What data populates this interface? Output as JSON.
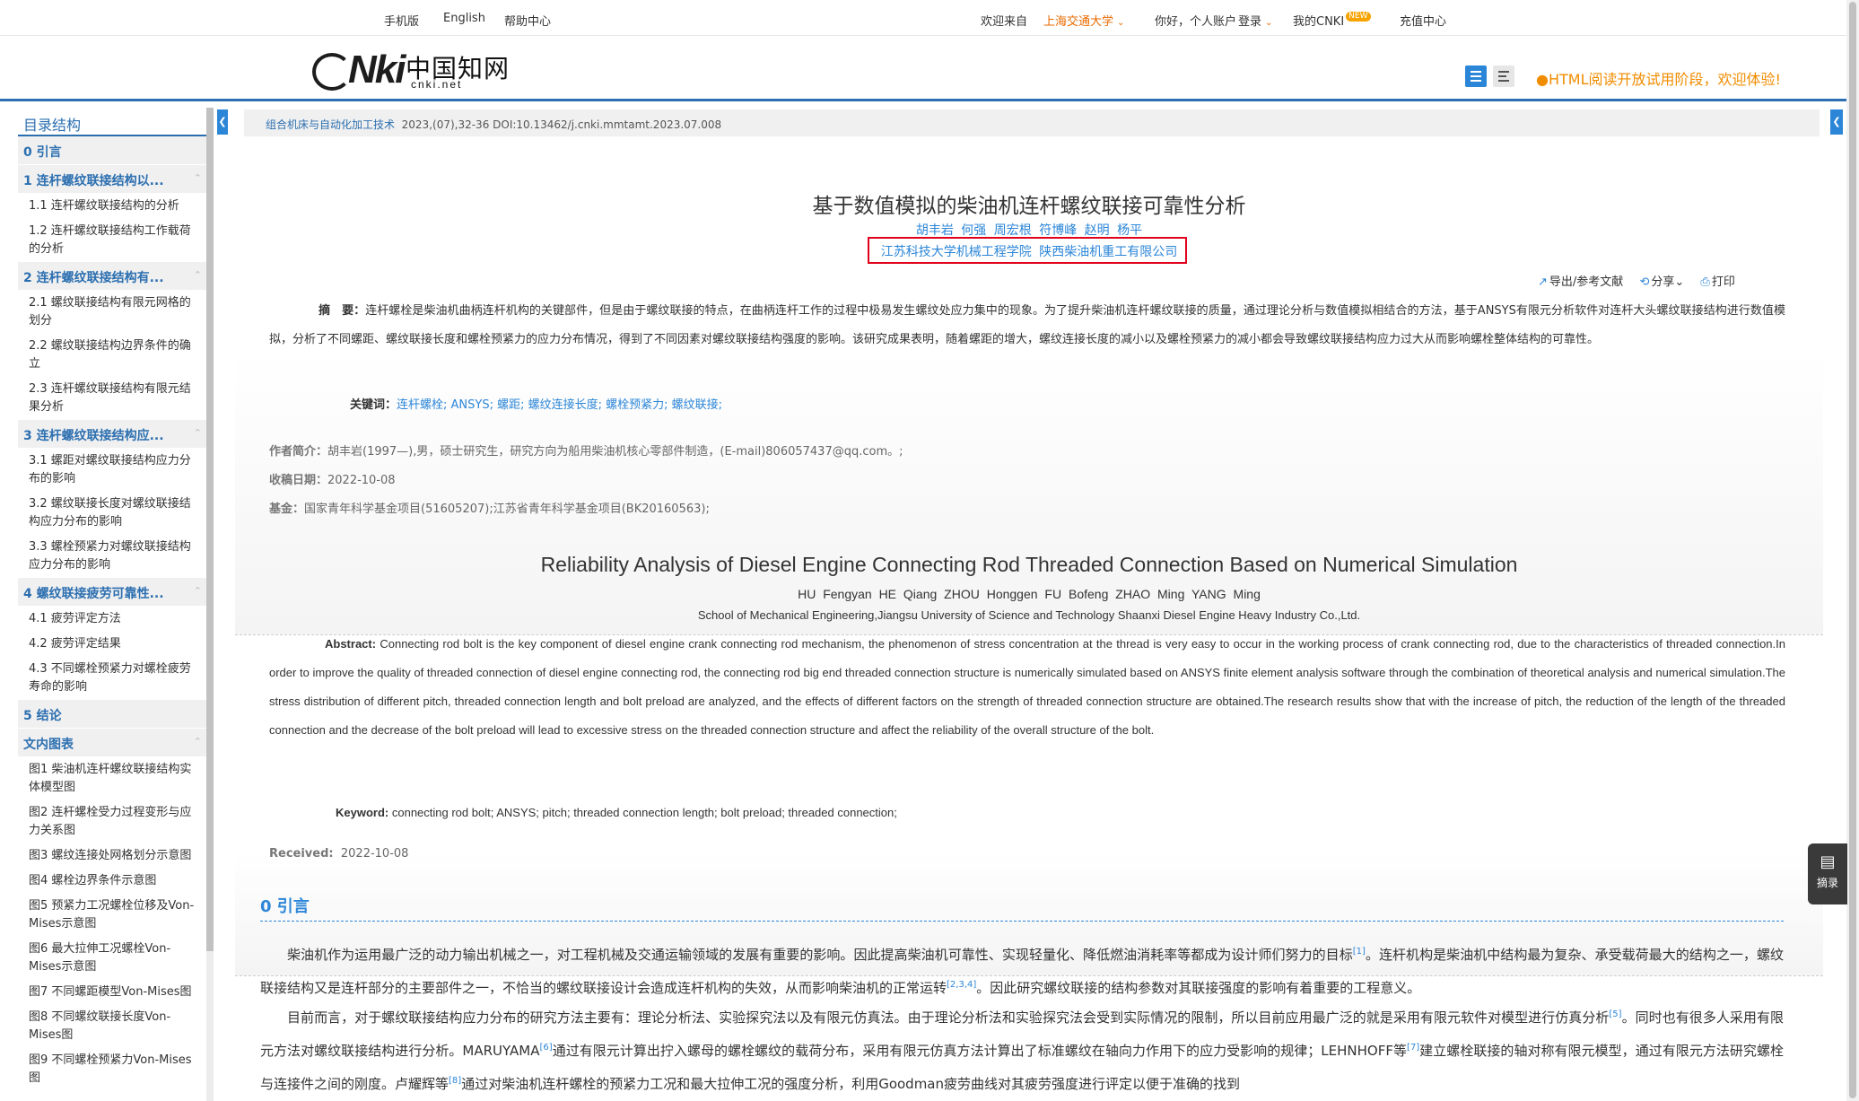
{
  "topbar": {
    "mobile": "手机版",
    "english": "English",
    "help": "帮助中心",
    "welcome": "欢迎来自",
    "institution": "上海交通大学",
    "greeting": "你好，个人账户",
    "login": "登录",
    "my_cnki": "我的CNKI",
    "new_badge": "NEW",
    "recharge": "充值中心"
  },
  "header": {
    "logo_text": "Nki",
    "logo_zh": "中国知网",
    "logo_net": "cnki.net",
    "notice": "HTML阅读开放试用阶段，欢迎体验!"
  },
  "toc": {
    "title": "目录结构",
    "sections": [
      {
        "label": "0 引言",
        "items": []
      },
      {
        "label": "1 连杆螺纹联接结构以...",
        "items": [
          "1.1 连杆螺纹联接结构的分析",
          "1.2 连杆螺纹联接结构工作载荷的分析"
        ]
      },
      {
        "label": "2 连杆螺纹联接结构有...",
        "items": [
          "2.1 螺纹联接结构有限元网格的划分",
          "2.2 螺纹联接结构边界条件的确立",
          "2.3 连杆螺纹联接结构有限元结果分析"
        ]
      },
      {
        "label": "3 连杆螺纹联接结构应...",
        "items": [
          "3.1 螺距对螺纹联接结构应力分布的影响",
          "3.2 螺纹联接长度对螺纹联接结构应力分布的影响",
          "3.3 螺栓预紧力对螺纹联接结构应力分布的影响"
        ]
      },
      {
        "label": "4 螺纹联接疲劳可靠性...",
        "items": [
          "4.1 疲劳评定方法",
          "4.2 疲劳评定结果",
          "4.3 不同螺栓预紧力对螺栓疲劳寿命的影响"
        ]
      },
      {
        "label": "5 结论",
        "items": []
      },
      {
        "label": "文内图表",
        "items": [
          "图1 柴油机连杆螺纹联接结构实体模型图",
          "图2 连杆螺栓受力过程变形与应力关系图",
          "图3 螺纹连接处网格划分示意图",
          "图4 螺栓边界条件示意图",
          "图5 预紧力工况螺栓位移及Von-Mises示意图",
          "图6 最大拉伸工况螺栓Von-Mises示意图",
          "图7 不同螺距模型Von-Mises图",
          "图8 不同螺纹联接长度Von-Mises图",
          "图9 不同螺栓预紧力Von-Mises图"
        ]
      }
    ]
  },
  "source": {
    "journal": "组合机床与自动化加工技术",
    "info": "2023,(07),32-36 DOI:10.13462/j.cnki.mmtamt.2023.07.008"
  },
  "article": {
    "title_zh": "基于数值模拟的柴油机连杆螺纹联接可靠性分析",
    "authors_zh": "胡丰岩 何强 周宏根 符博峰 赵明 杨平",
    "affil_zh": "江苏科技大学机械工程学院 陕西柴油机重工有限公司",
    "tools": {
      "export": "导出/参考文献",
      "share": "分享",
      "print": "打印"
    },
    "abstract_label_zh": "摘　要：",
    "abstract_zh": "连杆螺栓是柴油机曲柄连杆机构的关键部件，但是由于螺纹联接的特点，在曲柄连杆工作的过程中极易发生螺纹处应力集中的现象。为了提升柴油机连杆螺纹联接的质量，通过理论分析与数值模拟相结合的方法，基于ANSYS有限元分析软件对连杆大头螺纹联接结构进行数值模拟，分析了不同螺距、螺纹联接长度和螺栓预紧力的应力分布情况，得到了不同因素对螺纹联接结构强度的影响。该研究成果表明，随着螺距的增大，螺纹连接长度的减小以及螺栓预紧力的减小都会导致螺纹联接结构应力过大从而影响螺栓整体结构的可靠性。",
    "keywords_label_zh": "关键词：",
    "keywords_zh": "连杆螺栓; ANSYS; 螺距; 螺纹连接长度; 螺栓预紧力; 螺纹联接;",
    "author_bio_label": "作者简介：",
    "author_bio": "胡丰岩(1997—),男，硕士研究生，研究方向为船用柴油机核心零部件制造，(E-mail)806057437@qq.com。;",
    "received_label_zh": "收稿日期：",
    "received_zh": "2022-10-08",
    "fund_label": "基金：",
    "fund": "国家青年科学基金项目(51605207);江苏省青年科学基金项目(BK20160563);",
    "title_en": "Reliability Analysis of Diesel Engine Connecting Rod Threaded Connection Based on Numerical Simulation",
    "authors_en": "HU Fengyan   HE Qiang   ZHOU Honggen   FU Bofeng   ZHAO Ming   YANG Ming",
    "affil_en": "School of Mechanical Engineering,Jiangsu University of Science and Technology   Shaanxi Diesel Engine Heavy Industry Co.,Ltd.",
    "abstract_label_en": "Abstract:",
    "abstract_en": "Connecting rod bolt is the key component of diesel engine crank connecting rod mechanism, the phenomenon of stress concentration at the thread is very easy to occur in the working process of crank connecting rod, due to the characteristics of threaded connection.In order to improve the quality of threaded connection of diesel engine connecting rod, the connecting rod big end threaded connection structure is numerically simulated based on ANSYS finite element analysis software through the combination of theoretical analysis and numerical simulation.The stress distribution of different pitch, threaded connection length and bolt preload are analyzed, and the effects of different factors on the strength of threaded connection structure are obtained.The research results show that with the increase of pitch, the reduction of the length of the threaded connection and the decrease of the bolt preload will lead to excessive stress on the threaded connection structure and affect the reliability of the overall structure of the bolt.",
    "keywords_label_en": "Keyword:",
    "keywords_en": "connecting rod bolt; ANSYS; pitch; threaded connection length; bolt preload; threaded connection;",
    "received_label_en": "Received:",
    "received_en": "2022-10-08",
    "section0": "0 引言",
    "p1_a": "柴油机作为运用最广泛的动力输出机械之一，对工程机械及交通运输领域的发展有重要的影响。因此提高柴油机可靠性、实现轻量化、降低燃油消耗率等都成为设计师们努力的目标",
    "p1_ref1": "[1]",
    "p1_b": "。连杆机构是柴油机中结构最为复杂、承受载荷最大的结构之一，螺纹联接结构又是连杆部分的主要部件之一，不恰当的螺纹联接设计会造成连杆机构的失效，从而影响柴油机的正常运转",
    "p1_ref2": "[2,3,4]",
    "p1_c": "。因此研究螺纹联接的结构参数对其联接强度的影响有着重要的工程意义。",
    "p2_a": "目前而言，对于螺纹联接结构应力分布的研究方法主要有：理论分析法、实验探究法以及有限元仿真法。由于理论分析法和实验探究法会受到实际情况的限制，所以目前应用最广泛的就是采用有限元软件对模型进行仿真分析",
    "p2_ref1": "[5]",
    "p2_b": "。同时也有很多人采用有限元方法对螺纹联接结构进行分析。MARUYAMA",
    "p2_ref2": "[6]",
    "p2_c": "通过有限元计算出拧入螺母的螺栓螺纹的载荷分布，采用有限元仿真方法计算出了标准螺纹在轴向力作用下的应力受影响的规律；LEHNHOFF等",
    "p2_ref3": "[7]",
    "p2_d": "建立螺栓联接的轴对称有限元模型，通过有限元方法研究螺栓与连接件之间的刚度。卢耀辉等",
    "p2_ref4": "[8]",
    "p2_e": "通过对柴油机连杆螺栓的预紧力工况和最大拉伸工况的强度分析，利用Goodman疲劳曲线对其疲劳强度进行评定以便于准确的找到"
  },
  "excerpt_label": "摘录"
}
